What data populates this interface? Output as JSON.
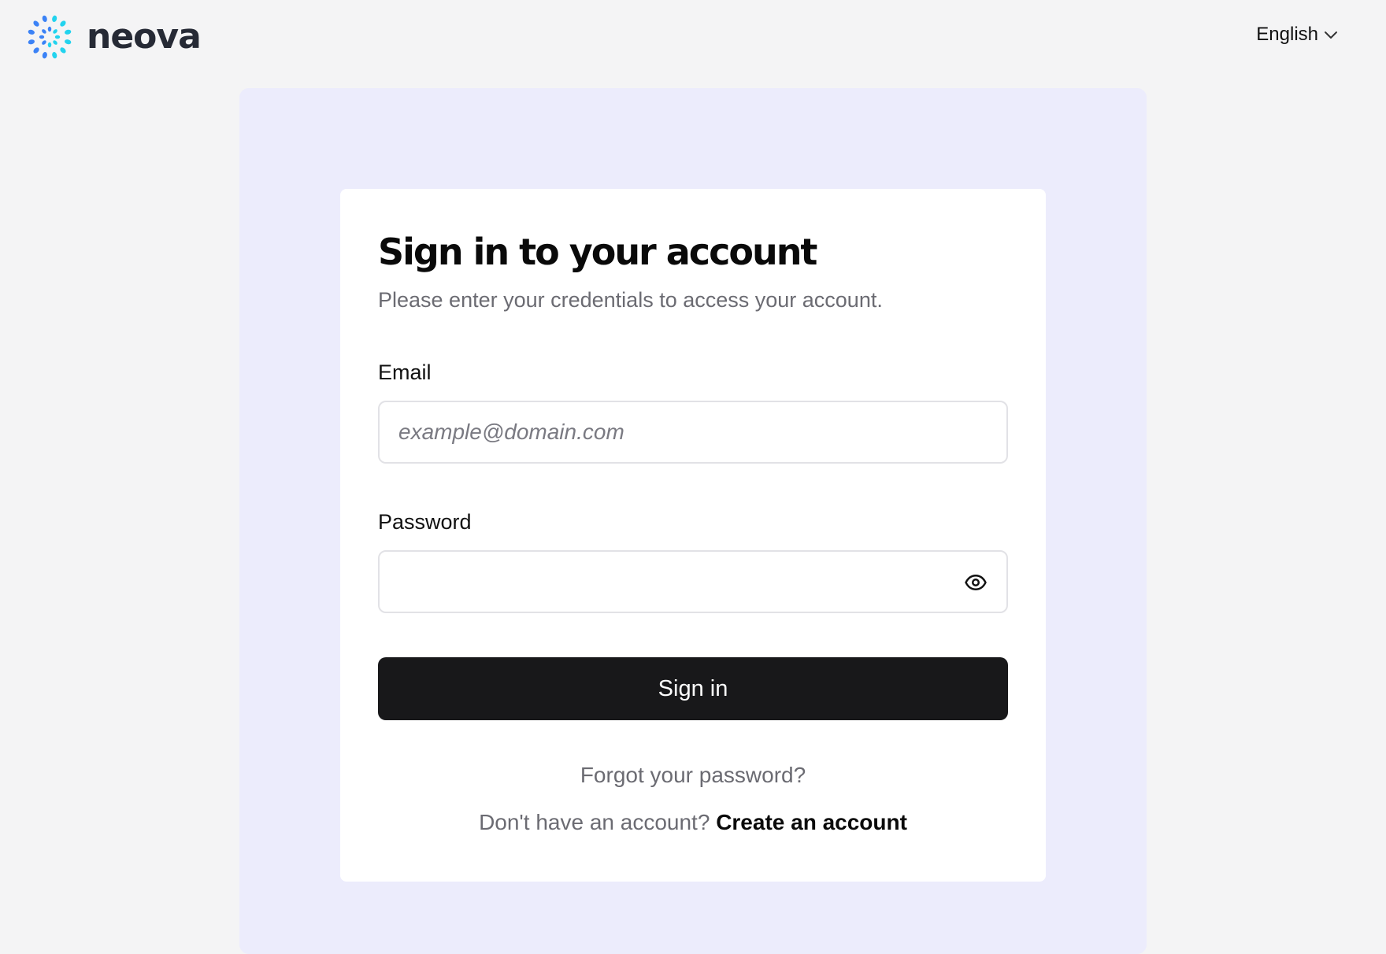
{
  "header": {
    "brand_name": "neova",
    "language": "English",
    "logo_icon": "dotted-burst-logo",
    "dropdown_icon": "chevron-down-icon"
  },
  "colors": {
    "page_bg": "#f4f4f5",
    "panel_bg": "#ececfc",
    "card_bg": "#ffffff",
    "primary_button": "#18181a",
    "logo_blue": "#3b82f6",
    "logo_cyan": "#22d3ee"
  },
  "form": {
    "title": "Sign in to your account",
    "subtitle": "Please enter your credentials to access your account.",
    "email": {
      "label": "Email",
      "placeholder": "example@domain.com",
      "value": ""
    },
    "password": {
      "label": "Password",
      "placeholder": "",
      "value": "",
      "toggle_icon": "eye-icon"
    },
    "submit_label": "Sign in",
    "forgot_link": "Forgot your password?",
    "signup_prompt": "Don't have an account?",
    "signup_link": "Create an account"
  }
}
